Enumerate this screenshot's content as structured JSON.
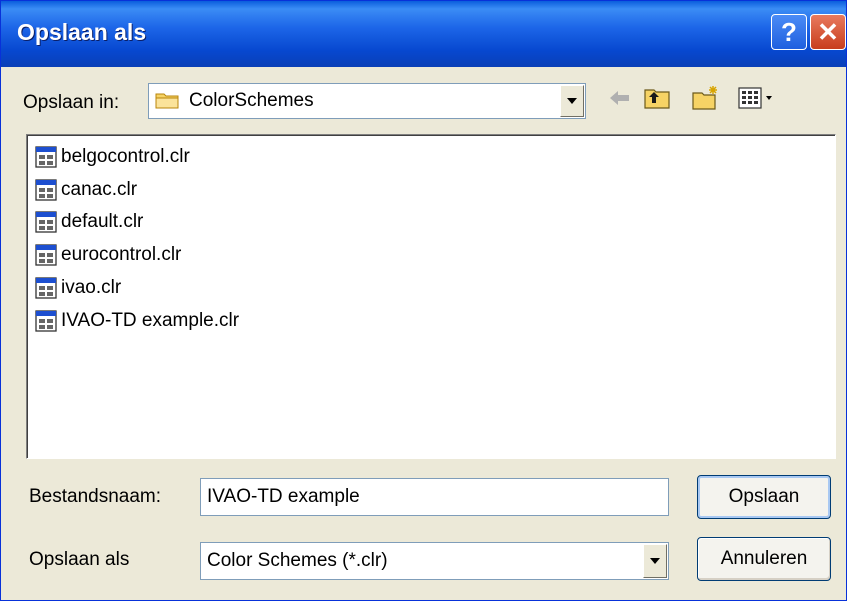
{
  "window": {
    "title": "Opslaan als"
  },
  "titlebar_buttons": {
    "help": "?",
    "close": "✕"
  },
  "look_in": {
    "label": "Opslaan in:",
    "value": "ColorSchemes"
  },
  "toolbar": [
    "back-icon",
    "up-folder-icon",
    "new-folder-icon",
    "view-menu-icon"
  ],
  "files": [
    "belgocontrol.clr",
    "canac.clr",
    "default.clr",
    "eurocontrol.clr",
    "ivao.clr",
    "IVAO-TD example.clr"
  ],
  "filename": {
    "label": "Bestandsnaam:",
    "value": "IVAO-TD example"
  },
  "filetype": {
    "label": "Opslaan als",
    "value": "Color Schemes (*.clr)"
  },
  "buttons": {
    "save": "Opslaan",
    "cancel": "Annuleren"
  }
}
